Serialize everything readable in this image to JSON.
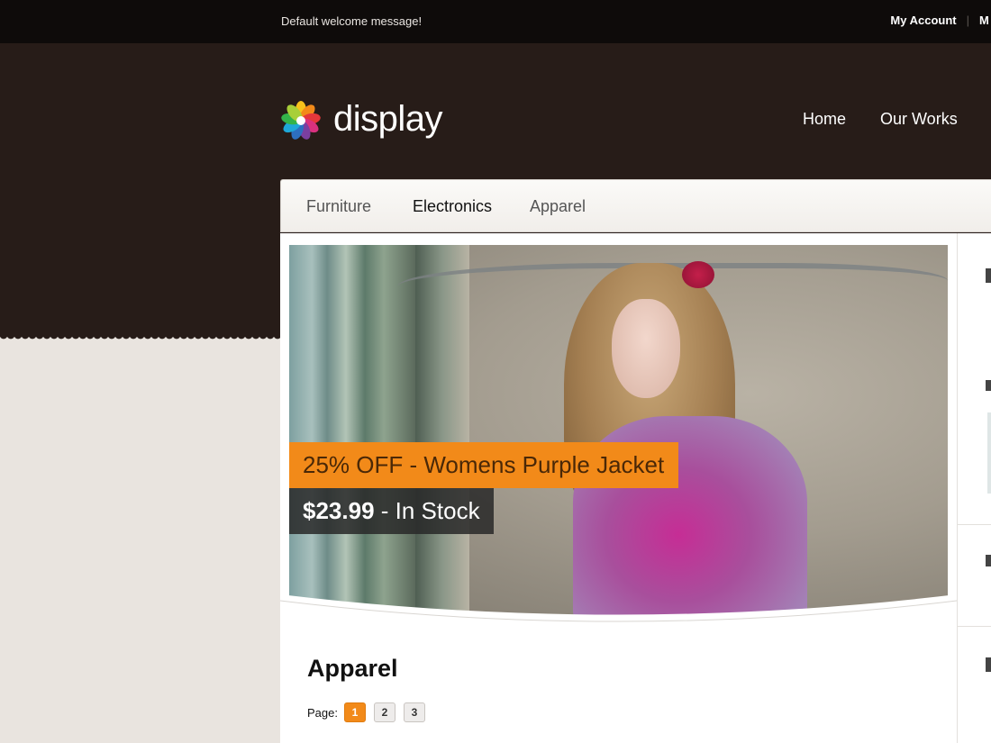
{
  "topbar": {
    "welcome": "Default welcome message!",
    "account_label": "My Account",
    "next_label_partial": "M"
  },
  "logo": {
    "text": "display"
  },
  "main_nav": [
    "Home",
    "Our Works"
  ],
  "category_nav": {
    "items": [
      "Furniture",
      "Electronics",
      "Apparel"
    ],
    "active": "Electronics"
  },
  "hero": {
    "promo": "25% OFF - Womens Purple Jacket",
    "price": "$23.99",
    "availability": " - In Stock"
  },
  "section": {
    "title": "Apparel"
  },
  "pager": {
    "label": "Page:",
    "pages": [
      "1",
      "2",
      "3"
    ],
    "current": "1"
  },
  "colors": {
    "accent": "#f28a19",
    "header_bg": "#271c18",
    "topbar_bg": "#0e0b0a"
  }
}
